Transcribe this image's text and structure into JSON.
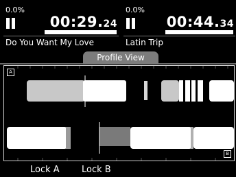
{
  "decks": {
    "a": {
      "percent": "0.0%",
      "time_main": "00:29.",
      "time_frac": "24",
      "progress": 0.35,
      "title": "Do You Want My Love"
    },
    "b": {
      "percent": "0.0%",
      "time_main": "00:44.",
      "time_frac": "34",
      "progress": 0.37,
      "title": "Latin Trip"
    }
  },
  "profile": {
    "tab_label": "Profile View",
    "marker_a": "A",
    "marker_b": "B"
  },
  "footer": {
    "lock_a": "Lock A",
    "lock_b": "Lock B"
  },
  "colors": {
    "background": "#000000",
    "tab": "#7c7c7c",
    "segment_light": "#ffffff",
    "segment_mid": "#c8c8c8",
    "segment_dark": "#7a7a7a"
  }
}
